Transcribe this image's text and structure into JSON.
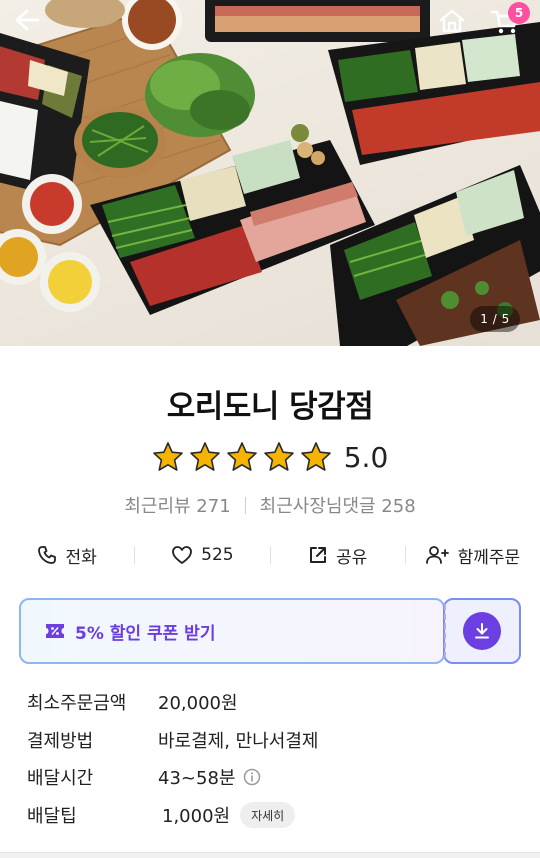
{
  "hero": {
    "image_description": "도시락 용기에 담긴 오리훈제, 쌈채소, 부추, 소스 구성",
    "page_counter": "1 / 5"
  },
  "nav": {
    "back_icon": "arrow-left-icon",
    "home_icon": "home-icon",
    "cart_icon": "cart-icon",
    "cart_badge": "5"
  },
  "store": {
    "name": "오리도니 당감점",
    "rating_value": "5.0",
    "rating_stars": 5,
    "star_color": "#f5b400",
    "review_label": "최근리뷰 271",
    "owner_reply_label": "최근사장님댓글 258"
  },
  "actions": {
    "call": {
      "icon": "phone-icon",
      "label": "전화"
    },
    "like": {
      "icon": "heart-icon",
      "label": "525"
    },
    "share": {
      "icon": "share-icon",
      "label": "공유"
    },
    "group_order": {
      "icon": "add-person-icon",
      "label": "함께주문"
    }
  },
  "coupon": {
    "icon": "discount-ticket-icon",
    "label": "5% 할인 쿠폰 받기",
    "download_icon": "download-icon",
    "accent_color": "#6c3fe2"
  },
  "info": {
    "min_order": {
      "label": "최소주문금액",
      "value": "20,000원"
    },
    "payment": {
      "label": "결제방법",
      "value": "바로결제, 만나서결제"
    },
    "delivery_time": {
      "label": "배달시간",
      "value": "43~58분",
      "icon": "info-circle-icon"
    },
    "delivery_tip": {
      "label": "배달팁",
      "value": "1,000원",
      "detail_button": "자세히"
    }
  }
}
